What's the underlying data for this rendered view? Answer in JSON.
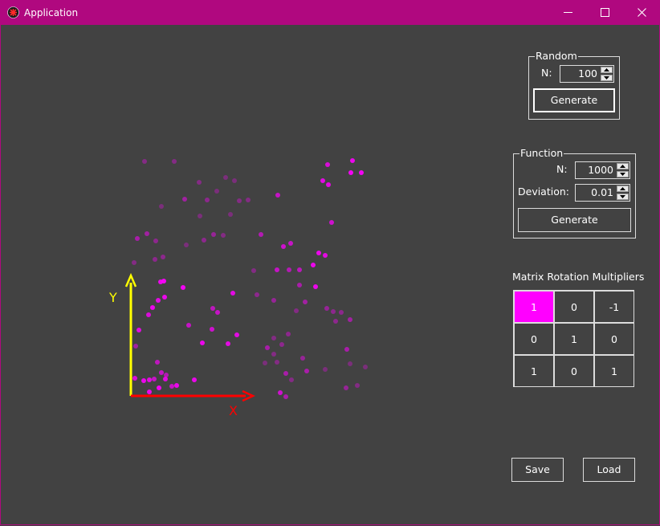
{
  "window": {
    "title": "Application",
    "accent": "#b0087f"
  },
  "random": {
    "title": "Random",
    "n_label": "N:",
    "n_value": "100",
    "generate_label": "Generate"
  },
  "function": {
    "title": "Function",
    "n_label": "N:",
    "n_value": "1000",
    "deviation_label": "Deviation:",
    "deviation_value": "0.01",
    "generate_label": "Generate"
  },
  "matrix": {
    "title": "Matrix Rotation Multipliers",
    "rows": [
      [
        "1",
        "0",
        "-1"
      ],
      [
        "0",
        "1",
        "0"
      ],
      [
        "1",
        "0",
        "1"
      ]
    ],
    "selected_color": "#ff00ff"
  },
  "axes": {
    "x_label": "X",
    "y_label": "Y",
    "x_color": "#ff0000",
    "y_color": "#ffff00"
  },
  "point_color": "#ff00ff",
  "footer": {
    "save_label": "Save",
    "load_label": "Load"
  }
}
